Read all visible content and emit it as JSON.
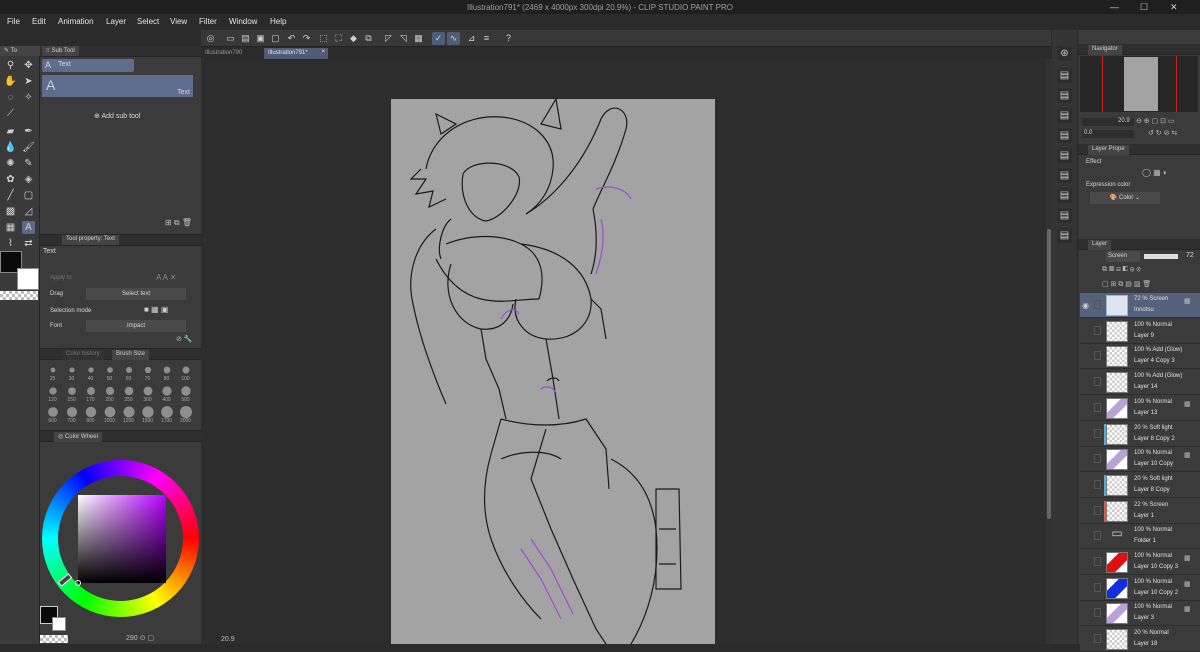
{
  "window": {
    "title": "Illustration791* (2469 x 4000px 300dpi 20.9%)  -  CLIP STUDIO PAINT PRO",
    "controls": {
      "minimize": "—",
      "maximize": "☐",
      "close": "✕"
    }
  },
  "menu": [
    "File",
    "Edit",
    "Animation",
    "Layer",
    "Select",
    "View",
    "Filter",
    "Window",
    "Help"
  ],
  "doc_tabs": [
    {
      "label": "Illustration790",
      "active": false
    },
    {
      "label": "Illustration791*",
      "active": true,
      "close": "×"
    }
  ],
  "tools_tab": "To",
  "subtool": {
    "tab": "Sub Tool",
    "group_label": "Text",
    "item_glyph": "A",
    "item_label": "Text",
    "add_label": "Add sub tool"
  },
  "tool_property": {
    "tab": "Tool property: Text",
    "name": "Text",
    "rows": [
      {
        "label": "Apply to",
        "value": ""
      },
      {
        "label": "Drag",
        "value": "Select text"
      },
      {
        "label": "Selection mode",
        "value": ""
      },
      {
        "label": "Font",
        "value": "Impact"
      }
    ]
  },
  "brush_size": {
    "tabs": [
      "Color history",
      "Brush Size"
    ],
    "sizes": [
      "25",
      "30",
      "40",
      "50",
      "60",
      "70",
      "80",
      "100",
      "120",
      "150",
      "170",
      "200",
      "250",
      "300",
      "400",
      "500",
      "600",
      "700",
      "800",
      "1000",
      "1200",
      "1500",
      "1700",
      "2000"
    ]
  },
  "color_wheel": {
    "tab": "Color Wheel",
    "readout": "290",
    "main_color": "#0a0a0a",
    "sub_color": "#ffffff",
    "square_hue": "#b400ff"
  },
  "navigator": {
    "tab": "Navigator",
    "zoom": "20.9",
    "angle": "0.0"
  },
  "layer_property": {
    "tab": "Layer Prope",
    "effect_label": "Effect",
    "expression_label": "Expression color",
    "expression_value": "Color"
  },
  "layer_panel": {
    "tab": "Layer",
    "blend": "Screen",
    "opacity": "72",
    "layers": [
      {
        "mode": "72 % Screen",
        "name": "Innotsu",
        "selected": true,
        "clip": "",
        "kind": "text"
      },
      {
        "mode": "100 % Normal",
        "name": "Layer 9",
        "selected": false,
        "clip": "",
        "kind": "blank"
      },
      {
        "mode": "100 % Add (Glow)",
        "name": "Layer 4 Copy 3",
        "selected": false,
        "clip": "",
        "kind": "blank"
      },
      {
        "mode": "100 % Add (Glow)",
        "name": "Layer 14",
        "selected": false,
        "clip": "",
        "kind": "blank"
      },
      {
        "mode": "100 % Normal",
        "name": "Layer 13",
        "selected": false,
        "clip": "",
        "kind": "sketch"
      },
      {
        "mode": "20 % Soft light",
        "name": "Layer 8 Copy 2",
        "selected": false,
        "clip": "#4ab0e0",
        "kind": "blank"
      },
      {
        "mode": "100 % Normal",
        "name": "Layer 10 Copy",
        "selected": false,
        "clip": "",
        "kind": "sketch"
      },
      {
        "mode": "20 % Soft light",
        "name": "Layer 8 Copy",
        "selected": false,
        "clip": "#4ab0e0",
        "kind": "blank"
      },
      {
        "mode": "22 % Screen",
        "name": "Layer 1",
        "selected": false,
        "clip": "#e05a4a",
        "kind": "blank"
      },
      {
        "mode": "100 % Normal",
        "name": "Folder 1",
        "selected": false,
        "clip": "",
        "kind": "folder"
      },
      {
        "mode": "100 % Normal",
        "name": "Layer 10 Copy 3",
        "selected": false,
        "clip": "",
        "kind": "red"
      },
      {
        "mode": "100 % Normal",
        "name": "Layer 10 Copy 2",
        "selected": false,
        "clip": "",
        "kind": "blue"
      },
      {
        "mode": "100 % Normal",
        "name": "Layer 3",
        "selected": false,
        "clip": "",
        "kind": "sketch"
      },
      {
        "mode": "20 % Normal",
        "name": "Layer 18",
        "selected": false,
        "clip": "",
        "kind": "blank"
      }
    ]
  },
  "canvas": {
    "paper_color": "#a3a3a3",
    "line_color": "#1a1a1a",
    "accent_color": "#9a4fd0",
    "zoom_readout": "20.9"
  }
}
